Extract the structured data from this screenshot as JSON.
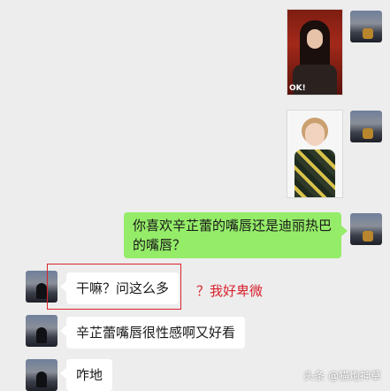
{
  "messages": {
    "sent_question": "你喜欢辛芷蕾的嘴唇还是迪丽热巴的嘴唇？",
    "reply_1": "干嘛？问这么多",
    "reply_2": "辛芷蕾嘴唇很性感啊又好看",
    "reply_3": "咋地"
  },
  "photo_1_caption": "OK!",
  "annotation": "？我好卑微",
  "watermark": "头条 @猫炮神草",
  "colors": {
    "sent_bubble": "#95ec69",
    "received_bubble": "#ffffff",
    "highlight": "#d9232d",
    "background": "#ededed"
  }
}
